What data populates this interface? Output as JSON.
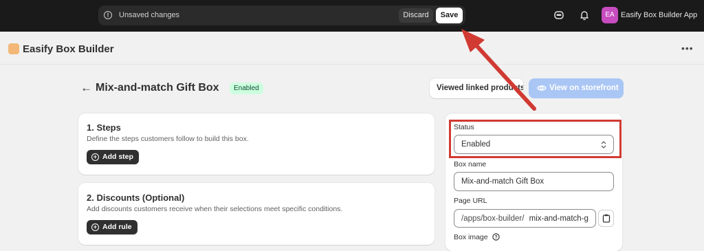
{
  "topbar": {
    "save_bar": {
      "message": "Unsaved changes",
      "discard_label": "Discard",
      "save_label": "Save"
    },
    "avatar_initials": "EA",
    "app_name": "Easify Box Builder App"
  },
  "app_header": {
    "title": "Easify Box Builder"
  },
  "page": {
    "title": "Mix-and-match Gift Box",
    "status_badge": "Enabled",
    "viewed_linked_label": "Viewed linked products",
    "view_storefront_label": "View on storefront"
  },
  "steps_card": {
    "title": "1. Steps",
    "description": "Define the steps customers follow to build this box.",
    "button_label": "Add step"
  },
  "discounts_card": {
    "title": "2. Discounts (Optional)",
    "description": "Add discounts customers receive when their selections meet specific conditions.",
    "button_label": "Add rule"
  },
  "sidebar": {
    "status_label": "Status",
    "status_value": "Enabled",
    "box_name_label": "Box name",
    "box_name_value": "Mix-and-match Gift Box",
    "page_url_label": "Page URL",
    "page_url_prefix": "/apps/box-builder/",
    "page_url_value": "mix-and-match-g",
    "box_image_label": "Box image"
  },
  "colors": {
    "annotation": "#d03a32",
    "badge_bg": "#cdfedf",
    "storefront_button": "#a9c6f5"
  }
}
